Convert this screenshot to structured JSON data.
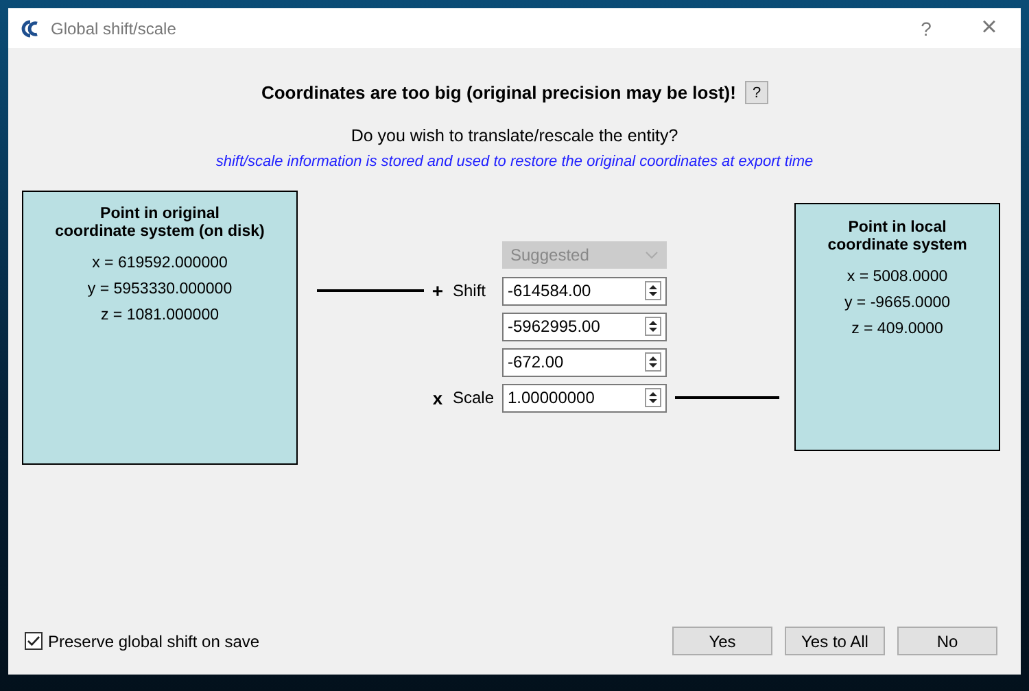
{
  "window": {
    "title": "Global shift/scale",
    "help_glyph": "?",
    "close_glyph": "×"
  },
  "heading": "Coordinates are too big (original precision may be lost)!",
  "help_button": "?",
  "question": "Do you wish to translate/rescale the entity?",
  "info": "shift/scale information is stored and used to restore the original coordinates at export time",
  "original_point": {
    "title": "Point in original\ncoordinate system (on disk)",
    "lines": [
      "x = 619592.000000",
      "y = 5953330.000000",
      "z = 1081.000000"
    ]
  },
  "shift": {
    "preset": {
      "value": "Suggested",
      "disabled": true
    },
    "sign": "+",
    "label": "Shift",
    "values": [
      "-614584.00",
      "-5962995.00",
      "-672.00"
    ]
  },
  "scale": {
    "sign": "x",
    "label": "Scale",
    "value": "1.00000000"
  },
  "local_point": {
    "title": "Point in local\ncoordinate system",
    "lines": [
      "x = 5008.0000",
      "y = -9665.0000",
      "z = 409.0000"
    ]
  },
  "preserve": {
    "label": "Preserve global shift on save",
    "checked": true
  },
  "buttons": [
    "Yes",
    "Yes to All",
    "No"
  ]
}
